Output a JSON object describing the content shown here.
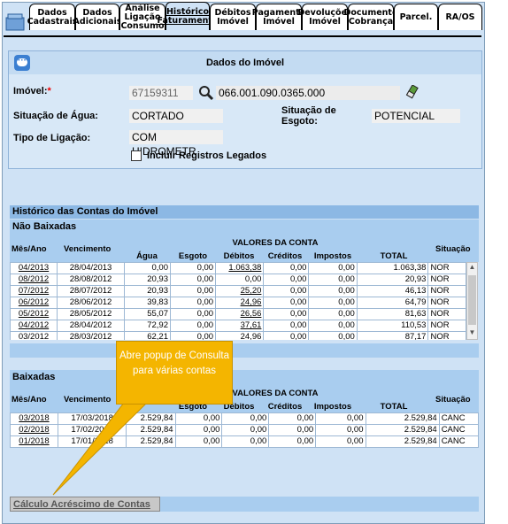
{
  "tabs": [
    {
      "label": "Dados Cadastrais"
    },
    {
      "label": "Dados Adicionais"
    },
    {
      "label": "Análise Ligação Consumo"
    },
    {
      "label": "Histórico Faturamento"
    },
    {
      "label": "Débitos Imóvel"
    },
    {
      "label": "Pagamento Imóvel"
    },
    {
      "label": "Devoluções Imóvel"
    },
    {
      "label": "Documento Cobrança"
    },
    {
      "label": "Parcel."
    },
    {
      "label": "RA/OS"
    }
  ],
  "panel": {
    "title": "Dados do Imóvel",
    "imovel_label": "Imóvel:",
    "required_mark": "*",
    "imovel_value": "67159311",
    "inscricao": "066.001.090.0365.000",
    "situacao_agua_label": "Situação de Água:",
    "situacao_agua_value": "CORTADO",
    "situacao_esgoto_label": "Situação de Esgoto:",
    "situacao_esgoto_value": "POTENCIAL",
    "tipo_ligacao_label": "Tipo de Ligação:",
    "tipo_ligacao_value": "COM HIDROMETR",
    "incluir_legados_label": "Incluir Registros Legados",
    "incluir_legados_checked": false
  },
  "history": {
    "title": "Histórico das Contas do Imóvel",
    "columns": {
      "mes_ano": "Mês/Ano",
      "vencimento": "Vencimento",
      "valores": "VALORES DA CONTA",
      "agua": "Água",
      "esgoto": "Esgoto",
      "debitos": "Débitos",
      "creditos": "Créditos",
      "impostos": "Impostos",
      "total": "TOTAL",
      "situacao": "Situação"
    },
    "nao_baixadas": {
      "title": "Não Baixadas",
      "rows": [
        {
          "mes": "04/2013",
          "venc": "28/04/2013",
          "agua": "0,00",
          "esgoto": "0,00",
          "debitos": "1.063,38",
          "creditos": "0,00",
          "impostos": "0,00",
          "total": "1.063,38",
          "sit": "NOR"
        },
        {
          "mes": "08/2012",
          "venc": "28/08/2012",
          "agua": "20,93",
          "esgoto": "0,00",
          "debitos": "0,00",
          "creditos": "0,00",
          "impostos": "0,00",
          "total": "20,93",
          "sit": "NOR"
        },
        {
          "mes": "07/2012",
          "venc": "28/07/2012",
          "agua": "20,93",
          "esgoto": "0,00",
          "debitos": "25,20",
          "creditos": "0,00",
          "impostos": "0,00",
          "total": "46,13",
          "sit": "NOR"
        },
        {
          "mes": "06/2012",
          "venc": "28/06/2012",
          "agua": "39,83",
          "esgoto": "0,00",
          "debitos": "24,96",
          "creditos": "0,00",
          "impostos": "0,00",
          "total": "64,79",
          "sit": "NOR"
        },
        {
          "mes": "05/2012",
          "venc": "28/05/2012",
          "agua": "55,07",
          "esgoto": "0,00",
          "debitos": "26,56",
          "creditos": "0,00",
          "impostos": "0,00",
          "total": "81,63",
          "sit": "NOR"
        },
        {
          "mes": "04/2012",
          "venc": "28/04/2012",
          "agua": "72,92",
          "esgoto": "0,00",
          "debitos": "37,61",
          "creditos": "0,00",
          "impostos": "0,00",
          "total": "110,53",
          "sit": "NOR"
        },
        {
          "mes": "03/2012",
          "venc": "28/03/2012",
          "agua": "62,21",
          "esgoto": "0,00",
          "debitos": "24,96",
          "creditos": "0,00",
          "impostos": "0,00",
          "total": "87,17",
          "sit": "NOR"
        }
      ]
    },
    "baixadas": {
      "title": "Baixadas",
      "rows": [
        {
          "mes": "03/2018",
          "venc": "17/03/2018",
          "agua": "2.529,84",
          "esgoto": "0,00",
          "debitos": "0,00",
          "creditos": "0,00",
          "impostos": "0,00",
          "total": "2.529,84",
          "sit": "CANC"
        },
        {
          "mes": "02/2018",
          "venc": "17/02/2018",
          "agua": "2.529,84",
          "esgoto": "0,00",
          "debitos": "0,00",
          "creditos": "0,00",
          "impostos": "0,00",
          "total": "2.529,84",
          "sit": "CANC"
        },
        {
          "mes": "01/2018",
          "venc": "17/01/2018",
          "agua": "2.529,84",
          "esgoto": "0,00",
          "debitos": "0,00",
          "creditos": "0,00",
          "impostos": "0,00",
          "total": "2.529,84",
          "sit": "CANC"
        }
      ]
    }
  },
  "callout": {
    "text": "Abre popup de Consulta para várias contas"
  },
  "calc_link": {
    "label": "Cálculo Acréscimo de Contas"
  },
  "colors": {
    "accent": "#f4b500",
    "header_blue": "#8cb8e4",
    "panel_bg": "#cfe2f5"
  }
}
